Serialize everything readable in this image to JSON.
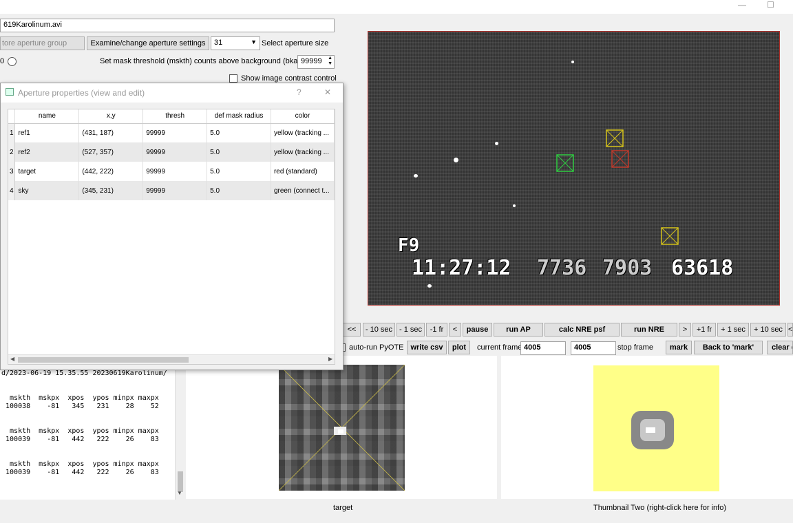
{
  "window": {
    "minimize_glyph": "—",
    "maximize_glyph": "☐"
  },
  "file_path": "619Karolinum.avi",
  "top_controls": {
    "restore_group": "tore aperture group",
    "examine_button": "Examine/change aperture settings",
    "aperture_size_value": "31",
    "aperture_size_label": "Select aperture size",
    "radio_label": "0",
    "mask_label": "Set mask threshold (mskth) counts above background (bkavg)",
    "mask_value": "99999",
    "contrast_label": "Show image contrast control"
  },
  "dialog": {
    "title": "Aperture properties (view and edit)",
    "help": "?",
    "close": "✕",
    "headers": [
      "name",
      "x,y",
      "thresh",
      "def mask radius",
      "color"
    ],
    "rows": [
      {
        "num": "1",
        "name": "ref1",
        "xy": "(431, 187)",
        "thresh": "99999",
        "radius": "5.0",
        "color": "yellow (tracking ..."
      },
      {
        "num": "2",
        "name": "ref2",
        "xy": "(527, 357)",
        "thresh": "99999",
        "radius": "5.0",
        "color": "yellow (tracking ..."
      },
      {
        "num": "3",
        "name": "target",
        "xy": "(442, 222)",
        "thresh": "99999",
        "radius": "5.0",
        "color": "red (standard)"
      },
      {
        "num": "4",
        "name": "sky",
        "xy": "(345, 231)",
        "thresh": "99999",
        "radius": "5.0",
        "color": "green (connect t..."
      }
    ]
  },
  "video_osd": {
    "line1": "F9",
    "time": "11:27:12",
    "n1": "7736",
    "n2": "7903",
    "n3": "63618"
  },
  "controls_row1": [
    "<<",
    "- 10 sec",
    "- 1 sec",
    "-1 fr",
    "<",
    "pause",
    "run AP",
    "calc NRE psf",
    "run NRE",
    ">",
    "+1 fr",
    "+ 1 sec",
    "+ 10 sec",
    "<"
  ],
  "controls_row2": {
    "autorun_label": "auto-run PyOTE",
    "write_csv": "write csv",
    "plot": "plot",
    "current_frame_label": "current frame",
    "current_frame_value": "4005",
    "stop_frame_value": "4005",
    "stop_frame_label": "stop frame",
    "mark": "mark",
    "back_to_mark": "Back to 'mark'",
    "clear": "clear c"
  },
  "console_lines": [
    "d/2023-06-19 15.35.55 20230619Karolinum/",
    "",
    "",
    "  mskth  mskpx  xpos  ypos minpx maxpx",
    " 100038    -81   345   231    28    52",
    "",
    "",
    "  mskth  mskpx  xpos  ypos minpx maxpx",
    " 100039    -81   442   222    26    83",
    "",
    "",
    "  mskth  mskpx  xpos  ypos minpx maxpx",
    " 100039    -81   442   222    26    83"
  ],
  "thumb_labels": {
    "one": "target",
    "two": "Thumbnail Two (right-click here for info)"
  },
  "colors": {
    "target_marker": "#c0392b",
    "ref_marker": "#d4c21a",
    "sky_marker": "#2ecc40",
    "thumb2_bg": "#ffff88"
  }
}
